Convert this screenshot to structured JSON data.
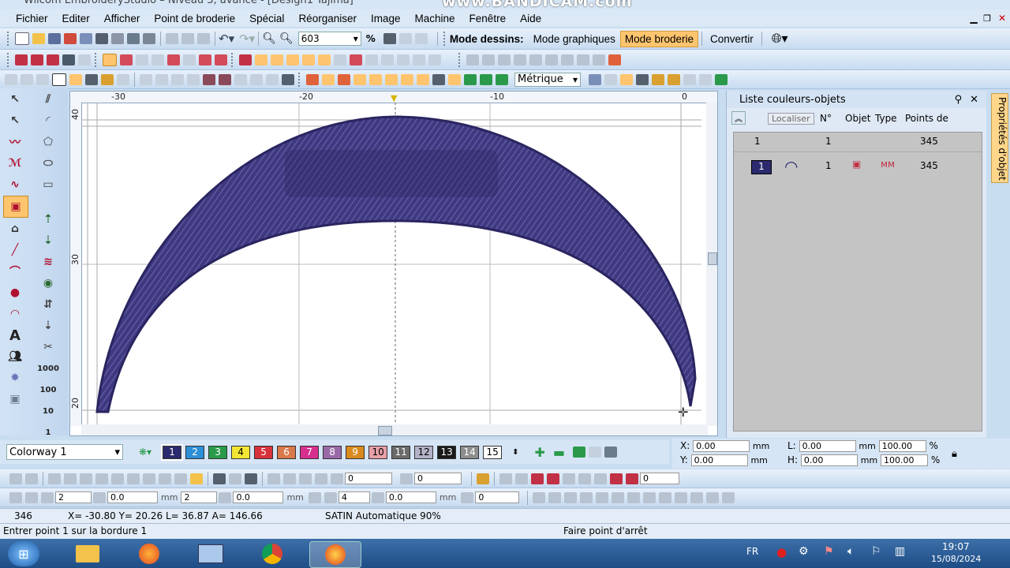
{
  "titlebar": {
    "text": "Wilcom EmbroideryStudio – Niveau 3, avancé - [Design1     Tajima]",
    "watermark": "www.BANDICAM.com"
  },
  "menu": [
    "Fichier",
    "Editer",
    "Afficher",
    "Point de broderie",
    "Spécial",
    "Réorganiser",
    "Image",
    "Machine",
    "Fenêtre",
    "Aide"
  ],
  "toolbar1": {
    "zoom_value": "603",
    "zoom_unit": "%",
    "mode_label": "Mode dessins:",
    "mode_graphiques": "Mode graphiques",
    "mode_broderie": "Mode broderie",
    "convertir": "Convertir"
  },
  "toolbar3": {
    "units": "Métrique"
  },
  "ruler": {
    "h_labels": [
      "-30",
      "-20",
      "-10",
      "0"
    ],
    "v_labels": [
      "40",
      "30",
      "20"
    ]
  },
  "left_tools": {
    "values": [
      "1000",
      "100",
      "10",
      "1"
    ]
  },
  "panel": {
    "title": "Liste couleurs-objets",
    "localiser": "Localiser",
    "headers": [
      "N°",
      "Objet",
      "Type",
      "Points de"
    ],
    "rows": [
      {
        "color_no": "1",
        "no": "1",
        "points": "345"
      },
      {
        "color_no": "1",
        "no": "1",
        "points": "345"
      }
    ]
  },
  "sidetab": "Propriétés d'objet",
  "colorway": {
    "label": "Colorway 1",
    "swatches": [
      {
        "n": "1",
        "c": "#2b2a6e"
      },
      {
        "n": "2",
        "c": "#2e8fd6"
      },
      {
        "n": "3",
        "c": "#2a9a4a"
      },
      {
        "n": "4",
        "c": "#f3e533"
      },
      {
        "n": "5",
        "c": "#d8323c"
      },
      {
        "n": "6",
        "c": "#d9784a"
      },
      {
        "n": "7",
        "c": "#d62f8e"
      },
      {
        "n": "8",
        "c": "#9a6aa8"
      },
      {
        "n": "9",
        "c": "#d98a1e"
      },
      {
        "n": "10",
        "c": "#e8a0a8"
      },
      {
        "n": "11",
        "c": "#6b6b6b"
      },
      {
        "n": "12",
        "c": "#b2b2c8"
      },
      {
        "n": "13",
        "c": "#1a1a1a"
      },
      {
        "n": "14",
        "c": "#8e8e8e"
      },
      {
        "n": "15",
        "c": "#ffffff"
      }
    ]
  },
  "coords": {
    "x_label": "X:",
    "x_val": "0.00",
    "y_label": "Y:",
    "y_val": "0.00",
    "l_label": "L:",
    "l_val": "0.00",
    "h_label": "H:",
    "h_val": "0.00",
    "unit": "mm",
    "pw": "100.00",
    "ph": "100.00",
    "pct": "%"
  },
  "toolbar_bottom": {
    "v1": "0",
    "v2": "0",
    "v3": "0",
    "w1": "2",
    "w2": "0.0",
    "w3": "2",
    "w4": "0.0",
    "w5": "4",
    "w6": "0.0",
    "w7": "0",
    "mm": "mm"
  },
  "status": {
    "count": "346",
    "readout": "X= -30.80 Y= 20.26 L= 36.87 A= 146.66",
    "stitch": "SATIN Automatique 90%",
    "prompt": "Entrer point 1 sur la bordure 1",
    "hint": "Faire point d'arrêt"
  },
  "taskbar": {
    "lang": "FR",
    "time": "19:07",
    "date": "15/08/2024"
  },
  "colors": {
    "thread": "#3f3a80",
    "thread_dark": "#2a2560",
    "accent": "#ffc56e"
  }
}
